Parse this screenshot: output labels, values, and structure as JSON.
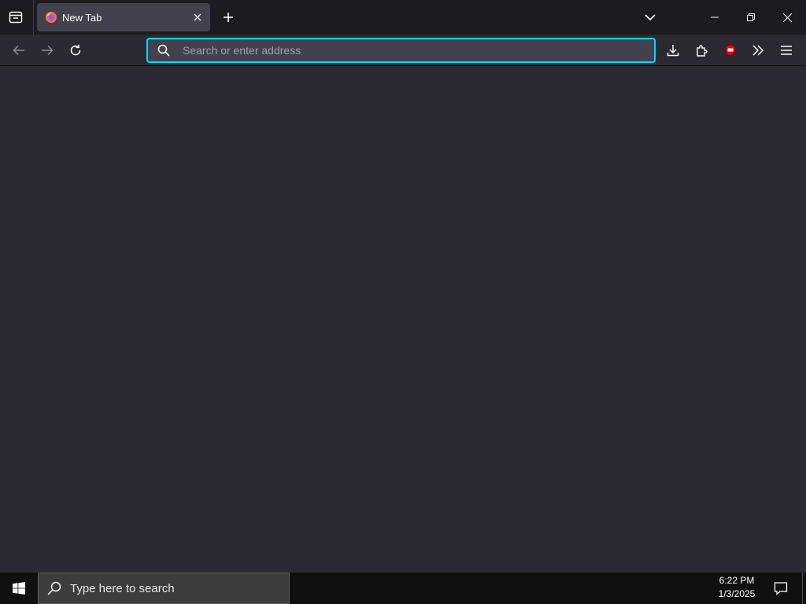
{
  "tab": {
    "title": "New Tab"
  },
  "urlbar": {
    "placeholder": "Search or enter address",
    "value": ""
  },
  "taskbar": {
    "search_placeholder": "Type here to search",
    "time": "6:22 PM",
    "date": "1/3/2025"
  },
  "icons": {
    "tab_manager": "tab-manager-icon",
    "favicon": "firefox-icon",
    "tab_close": "close-icon",
    "new_tab": "plus-icon",
    "list_all_tabs": "chevron-down-icon",
    "minimize": "minimize-icon",
    "restore": "restore-icon",
    "close_window": "close-icon",
    "back": "arrow-left-icon",
    "forward": "arrow-right-icon",
    "reload": "reload-icon",
    "search": "search-icon",
    "downloads": "download-icon",
    "extensions": "puzzle-icon",
    "ublock": "ublock-origin-icon",
    "overflow": "double-chevron-icon",
    "app_menu": "hamburger-icon",
    "start": "windows-icon",
    "taskbar_search": "search-icon",
    "notifications": "notification-icon"
  },
  "colors": {
    "accent_focus": "#00ddff",
    "toolbar": "#2b2a33",
    "tabstrip": "#1c1b22",
    "selected_tab": "#42414d",
    "taskbar": "#101010"
  }
}
